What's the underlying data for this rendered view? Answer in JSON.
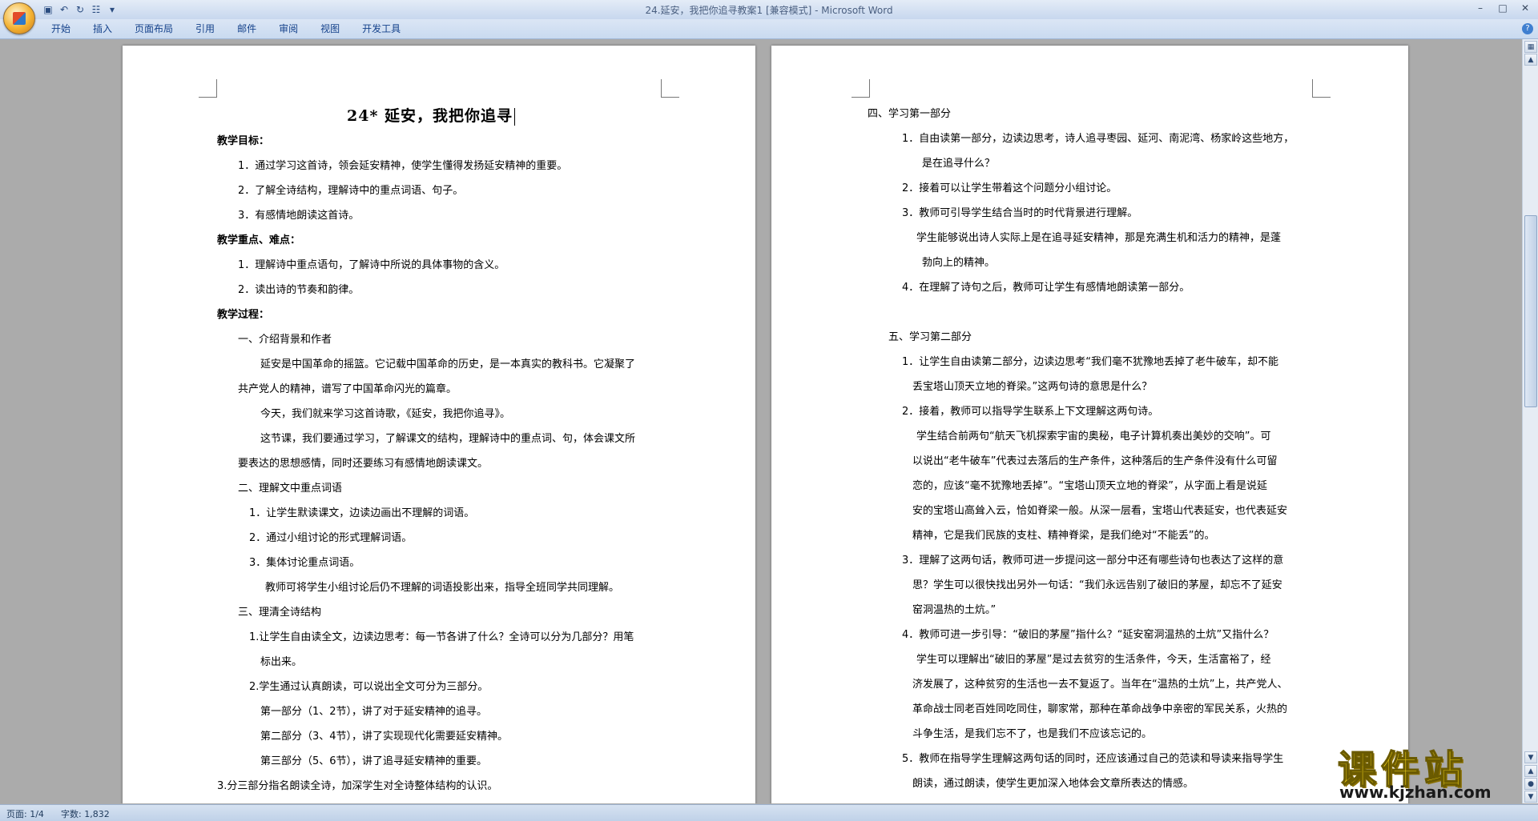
{
  "app": {
    "window_title": "24.延安，我把你追寻教案1 [兼容模式] - Microsoft Word",
    "tabs": [
      "开始",
      "插入",
      "页面布局",
      "引用",
      "邮件",
      "审阅",
      "视图",
      "开发工具"
    ]
  },
  "status": {
    "page": "页面: 1/4",
    "words": "字数: 1,832"
  },
  "page1": {
    "title": "24* 延安，我把你追寻",
    "lines": [
      "教学目标：",
      "1．通过学习这首诗，领会延安精神，使学生懂得发扬延安精神的重要。",
      "2．了解全诗结构，理解诗中的重点词语、句子。",
      "3．有感情地朗读这首诗。",
      "教学重点、难点：",
      "1．理解诗中重点语句，了解诗中所说的具体事物的含义。",
      "2．读出诗的节奏和韵律。",
      "教学过程：",
      "一、介绍背景和作者",
      "延安是中国革命的摇篮。它记载中国革命的历史，是一本真实的教科书。它凝聚了",
      "共产党人的精神，谱写了中国革命闪光的篇章。",
      "今天，我们就来学习这首诗歌，《延安，我把你追寻》。",
      "这节课，我们要通过学习，了解课文的结构，理解诗中的重点词、句，体会课文所",
      "要表达的思想感情，同时还要练习有感情地朗读课文。",
      "二、理解文中重点词语",
      "1．让学生默读课文，边读边画出不理解的词语。",
      "2．通过小组讨论的形式理解词语。",
      "3．集体讨论重点词语。",
      "教师可将学生小组讨论后仍不理解的词语投影出来，指导全班同学共同理解。",
      "三、理清全诗结构",
      "1.让学生自由读全文，边读边思考：每一节各讲了什么？全诗可以分为几部分？用笔",
      "标出来。",
      "2.学生通过认真朗读，可以说出全文可分为三部分。",
      "第一部分（1、2节），讲了对于延安精神的追寻。",
      "第二部分（3、4节），讲了实现现代化需要延安精神。",
      "第三部分（5、6节），讲了追寻延安精神的重要。",
      "3.分三部分指名朗读全诗，加深学生对全诗整体结构的认识。"
    ]
  },
  "page2": {
    "lines": [
      "四、学习第一部分",
      "1．自由读第一部分，边读边思考，诗人追寻枣园、延河、南泥湾、杨家岭这些地方，",
      "是在追寻什么？",
      "2．接着可以让学生带着这个问题分小组讨论。",
      "3．教师可引导学生结合当时的时代背景进行理解。",
      "学生能够说出诗人实际上是在追寻延安精神，那是充满生机和活力的精神，是蓬",
      "勃向上的精神。",
      "4．在理解了诗句之后，教师可让学生有感情地朗读第一部分。",
      "五、学习第二部分",
      "1．让学生自由读第二部分，边读边思考“我们毫不犹豫地丢掉了老牛破车，却不能",
      "丢宝塔山顶天立地的脊梁。”这两句诗的意思是什么？",
      "2．接着，教师可以指导学生联系上下文理解这两句诗。",
      "学生结合前两句“航天飞机探索宇宙的奥秘，电子计算机奏出美妙的交响”。可",
      "以说出“老牛破车”代表过去落后的生产条件，这种落后的生产条件没有什么可留",
      "恋的，应该“毫不犹豫地丢掉”。“宝塔山顶天立地的脊梁”，从字面上看是说延",
      "安的宝塔山高耸入云，恰如脊梁一般。从深一层看，宝塔山代表延安，也代表延安",
      "精神，它是我们民族的支柱、精神脊梁，是我们绝对“不能丢”的。",
      "3．理解了这两句话，教师可进一步提问这一部分中还有哪些诗句也表达了这样的意",
      "思？学生可以很快找出另外一句话：“我们永远告别了破旧的茅屋，却忘不了延安",
      "窑洞温热的土炕。”",
      "4．教师可进一步引导：“破旧的茅屋”指什么？“延安窑洞温热的土炕”又指什么？",
      "学生可以理解出“破旧的茅屋”是过去贫穷的生活条件，今天，生活富裕了，经",
      "济发展了，这种贫穷的生活也一去不复返了。当年在“温热的土炕”上，共产党人、",
      "革命战士同老百姓同吃同住，聊家常，那种在革命战争中亲密的军民关系，火热的",
      "斗争生活，是我们忘不了，也是我们不应该忘记的。",
      "5．教师在指导学生理解这两句话的同时，还应该通过自己的范读和导读来指导学生",
      "朗读，通过朗读，使学生更加深入地体会文章所表达的情感。"
    ]
  },
  "watermark": {
    "text": "课件站",
    "url": "www.kjzhan.com"
  }
}
